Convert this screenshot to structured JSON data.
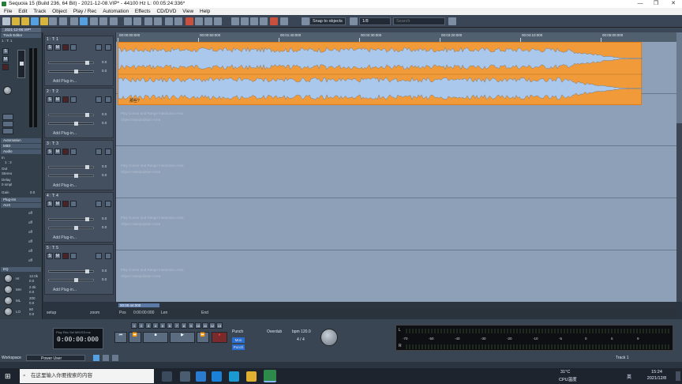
{
  "window": {
    "title": "Sequoia 15 (Build 236, 64 Bit)  -  2021-12-08.VIP*  -  44100 Hz L: 00:05:24:336*"
  },
  "menu": [
    "File",
    "Edit",
    "Track",
    "Object",
    "Play / Rec",
    "Automation",
    "Effects",
    "CD/DVD",
    "View",
    "Help"
  ],
  "toolbar": {
    "snap_label": "Snap to objects",
    "zoom_label": "1/8",
    "search_placeholder": "Search"
  },
  "tab": {
    "label": "2021-12-08.VIP*"
  },
  "left_panel": {
    "header": "Track Editor",
    "track_id": "1 : T: 1",
    "sections": [
      "Automation",
      "MIDI",
      "Audio",
      "Plug-ins",
      "AUX"
    ],
    "sub_labels": {
      "in": "In",
      "out": "Out",
      "delay": "Delay",
      "gain": "Gain"
    },
    "values": {
      "in": "1 : 2",
      "out": "Stereo",
      "delay": "0 smpl",
      "gain": "0.0"
    },
    "aux_off": [
      "off",
      "off",
      "off",
      "off",
      "off",
      "off"
    ],
    "eq_header": "EQ",
    "eq_bands": [
      {
        "label": "HI",
        "freq": "12.0k",
        "gain": "0.0"
      },
      {
        "label": "MH",
        "freq": "2.0k",
        "gain": "0.0"
      },
      {
        "label": "ML",
        "freq": "200",
        "gain": "0.0"
      },
      {
        "label": "LO",
        "freq": "60",
        "gain": "0.0"
      }
    ]
  },
  "tracks": [
    {
      "name": "1 : T: 1",
      "vol": "0.0",
      "pan": "0.0",
      "plugin": "Add Plug-in..."
    },
    {
      "name": "2 : T: 2",
      "vol": "0.0",
      "pan": "0.0",
      "plugin": "Add Plug-in..."
    },
    {
      "name": "3 : T: 3",
      "vol": "0.0",
      "pan": "0.0",
      "plugin": "Add Plug-in..."
    },
    {
      "name": "4 : T: 4",
      "vol": "0.0",
      "pan": "0.0",
      "plugin": "Add Plug-in..."
    },
    {
      "name": "5 : T: 5",
      "vol": "0.0",
      "pan": "0.0",
      "plugin": "Add Plug-in..."
    }
  ],
  "track_buttons": {
    "solo": "S",
    "mute": "M"
  },
  "timeline": {
    "ticks": [
      "00:00:00:000",
      "00:00:50:000",
      "00:01:40:000",
      "00:02:30:000",
      "00:03:20:000",
      "00:04:10:000",
      "00:05:00:000"
    ]
  },
  "clip": {
    "name": "那些?",
    "waveform_color": "#f19a3a",
    "fill_color": "#aac8ec"
  },
  "lane_hints": [
    "Play Cursor and Range Interaction Area",
    "Object Manipulation Area"
  ],
  "bottom_bar": {
    "setup": "setup",
    "zoom": "zoom",
    "pos_label": "Pos",
    "pos_value": "0:00:00:000",
    "len_label": "Len",
    "end_label": "End"
  },
  "scroll_time": "00:00:44:000",
  "transport": {
    "counter": "0:00:00:000",
    "counter_sub": "Play   Rec   Sel   MM:SS:ms",
    "punch": "Punch",
    "mon": "Mon",
    "punch2": "Punch",
    "overdub": "Overdub",
    "bpm": "bpm  120.0",
    "signature": "4 / 4",
    "markers": [
      "1",
      "2",
      "3",
      "4",
      "5",
      "6",
      "7",
      "8",
      "9",
      "10",
      "11",
      "12",
      "13"
    ]
  },
  "meter": {
    "scale": [
      "-70",
      "-50",
      "-40",
      "-30",
      "-20",
      "-10",
      "-5",
      "0",
      "6",
      "9"
    ],
    "ch_labels": [
      "L",
      "R"
    ]
  },
  "workspace": {
    "label": "Workspace",
    "value": "Power User",
    "track_label": "Track 1"
  },
  "taskbar": {
    "search_placeholder": "在这里输入你要搜索的内容",
    "temp": "31°C",
    "cpu": "CPU温度",
    "lang": "英",
    "time": "15:24",
    "date": "2021/12/8"
  }
}
